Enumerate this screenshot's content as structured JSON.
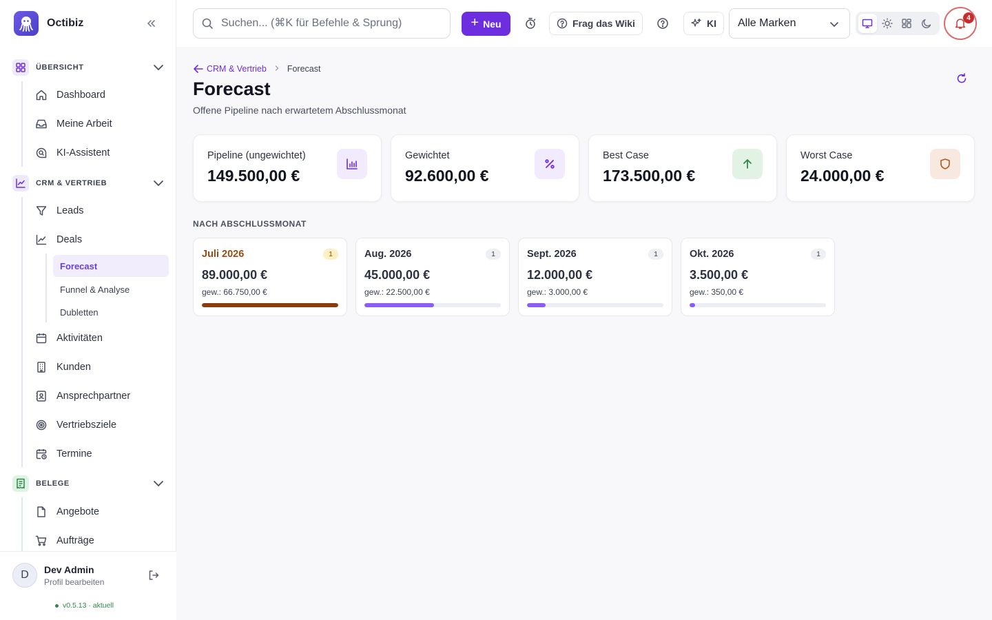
{
  "app": {
    "name": "Octibiz"
  },
  "sidebar": {
    "sections": {
      "overview": {
        "label": "ÜBERSICHT"
      },
      "crm": {
        "label": "CRM & VERTRIEB"
      },
      "belege": {
        "label": "BELEGE"
      }
    },
    "items": {
      "dashboard": "Dashboard",
      "my_work": "Meine Arbeit",
      "ai_assistant": "KI-Assistent",
      "leads": "Leads",
      "deals": "Deals",
      "forecast": "Forecast",
      "funnel": "Funnel & Analyse",
      "duplicates": "Dubletten",
      "activities": "Aktivitäten",
      "customers": "Kunden",
      "contacts": "Ansprechpartner",
      "sales_goals": "Vertriebsziele",
      "appointments": "Termine",
      "offers": "Angebote",
      "orders": "Aufträge"
    },
    "user": {
      "initial": "D",
      "name": "Dev Admin",
      "sub": "Profil bearbeiten"
    },
    "version": "v0.5.13 · aktuell"
  },
  "topbar": {
    "search_placeholder": "Suchen... (⌘K für Befehle & Sprung)",
    "new_label": "Neu",
    "wiki_label": "Frag das Wiki",
    "ai_label": "KI",
    "brand_select": "Alle Marken",
    "notification_count": "4"
  },
  "page": {
    "breadcrumb_parent": "CRM & Vertrieb",
    "breadcrumb_current": "Forecast",
    "title": "Forecast",
    "subtitle": "Offene Pipeline nach erwartetem Abschlussmonat"
  },
  "kpis": [
    {
      "label": "Pipeline (ungewichtet)",
      "value": "149.500,00 €",
      "icon": "bar-chart-icon"
    },
    {
      "label": "Gewichtet",
      "value": "92.600,00 €",
      "icon": "percent-icon"
    },
    {
      "label": "Best Case",
      "value": "173.500,00 €",
      "icon": "arrow-up-icon"
    },
    {
      "label": "Worst Case",
      "value": "24.000,00 €",
      "icon": "shield-icon"
    }
  ],
  "months_section_title": "NACH ABSCHLUSSMONAT",
  "months": [
    {
      "name": "Juli 2026",
      "count": "1",
      "value": "89.000,00 €",
      "weighted": "gew.: 66.750,00 €",
      "fill": 1.0,
      "color": "#8a3c0c"
    },
    {
      "name": "Aug. 2026",
      "count": "1",
      "value": "45.000,00 €",
      "weighted": "gew.: 22.500,00 €",
      "fill": 0.51,
      "color": "#8b5cf6"
    },
    {
      "name": "Sept. 2026",
      "count": "1",
      "value": "12.000,00 €",
      "weighted": "gew.: 3.000,00 €",
      "fill": 0.135,
      "color": "#8b5cf6"
    },
    {
      "name": "Okt. 2026",
      "count": "1",
      "value": "3.500,00 €",
      "weighted": "gew.: 350,00 €",
      "fill": 0.04,
      "color": "#8b5cf6"
    }
  ],
  "colors": {
    "accent": "#6d2ee0",
    "active_bg": "#f1edfd"
  }
}
